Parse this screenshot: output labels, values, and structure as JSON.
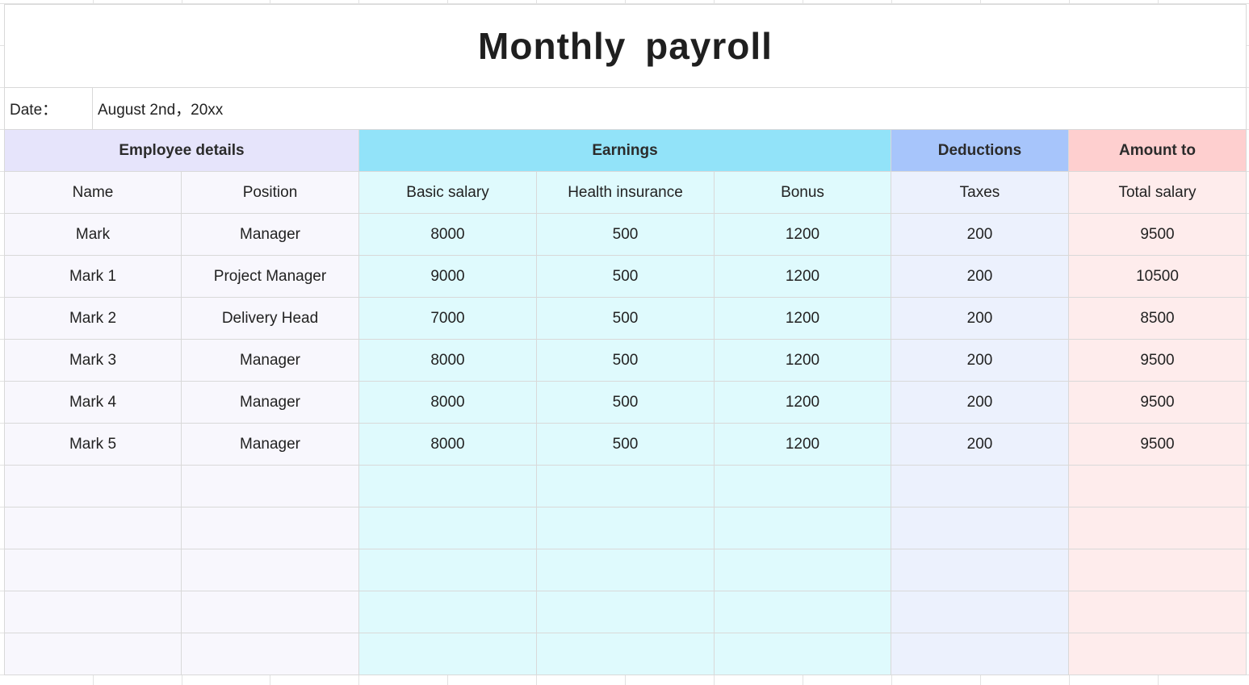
{
  "title": "Monthly  payroll",
  "date": {
    "label": "Date：",
    "value": "August 2nd，20xx"
  },
  "groups": [
    {
      "label": "Employee details"
    },
    {
      "label": "Earnings"
    },
    {
      "label": "Deductions"
    },
    {
      "label": "Amount to"
    }
  ],
  "columns": [
    "Name",
    "Position",
    "Basic salary",
    "Health insurance",
    "Bonus",
    "Taxes",
    "Total salary"
  ],
  "rows": [
    [
      "Mark",
      "Manager",
      "8000",
      "500",
      "1200",
      "200",
      "9500"
    ],
    [
      "Mark 1",
      "Project Manager",
      "9000",
      "500",
      "1200",
      "200",
      "10500"
    ],
    [
      "Mark 2",
      "Delivery Head",
      "7000",
      "500",
      "1200",
      "200",
      "8500"
    ],
    [
      "Mark 3",
      "Manager",
      "8000",
      "500",
      "1200",
      "200",
      "9500"
    ],
    [
      "Mark 4",
      "Manager",
      "8000",
      "500",
      "1200",
      "200",
      "9500"
    ],
    [
      "Mark 5",
      "Manager",
      "8000",
      "500",
      "1200",
      "200",
      "9500"
    ],
    [
      "",
      "",
      "",
      "",
      "",
      "",
      ""
    ],
    [
      "",
      "",
      "",
      "",
      "",
      "",
      ""
    ],
    [
      "",
      "",
      "",
      "",
      "",
      "",
      ""
    ],
    [
      "",
      "",
      "",
      "",
      "",
      "",
      ""
    ],
    [
      "",
      "",
      "",
      "",
      "",
      "",
      ""
    ]
  ],
  "colors": {
    "employee_header": "#e6e4fb",
    "employee_body": "#f8f7fd",
    "earnings_header": "#92e3f9",
    "earnings_body": "#dffafd",
    "deductions_header": "#a7c5fb",
    "deductions_body": "#ecf1fd",
    "amount_header": "#fecfcf",
    "amount_body": "#feecec"
  }
}
